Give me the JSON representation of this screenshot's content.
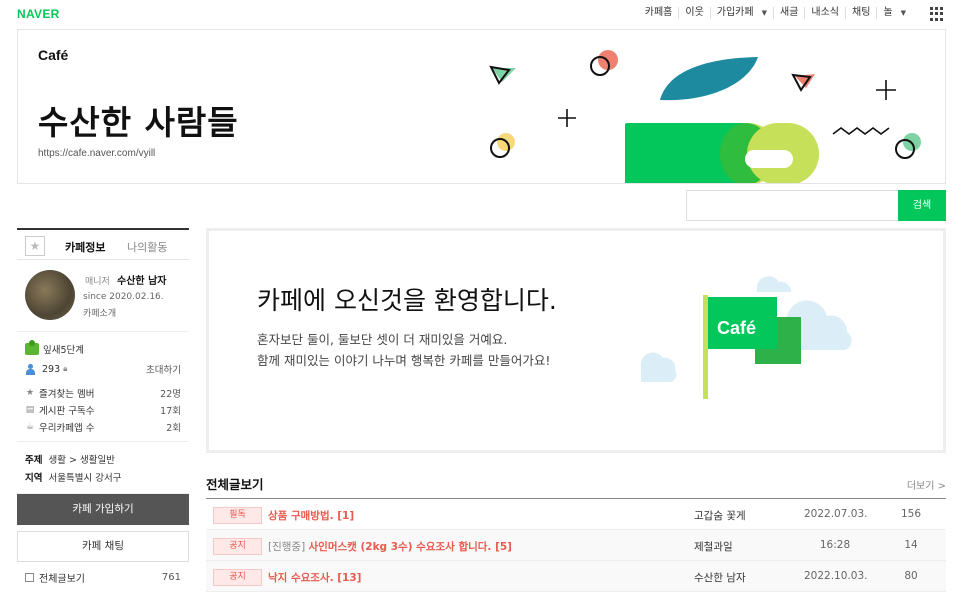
{
  "topbar": {
    "brand": "NAVER",
    "nav": [
      "카페홈",
      "이웃",
      "가입카페",
      "새글",
      "내소식",
      "채팅",
      "놀"
    ]
  },
  "header": {
    "logo": "Café",
    "title": "수산한 사람들",
    "url": "https://cafe.naver.com/vyill"
  },
  "search": {
    "button": "검색",
    "placeholder": ""
  },
  "sidebar": {
    "tabs": [
      "카페정보",
      "나의활동"
    ],
    "manager_label": "매니저",
    "manager_name": "수산한 남자",
    "since": "since 2020.02.16.",
    "intro": "카페소개",
    "level": "잎새5단계",
    "members": "293",
    "invite": "초대하기",
    "stats": [
      {
        "label": "즐겨찾는 멤버",
        "value": "22명"
      },
      {
        "label": "게시판 구독수",
        "value": "17회"
      },
      {
        "label": "우리카페앱 수",
        "value": "2회"
      }
    ],
    "topic_label": "주제",
    "topic_value": "생활 > 생활일반",
    "region_label": "지역",
    "region_value": "서울특별시 강서구",
    "join": "카페 가입하기",
    "chat": "카페 채팅",
    "all_posts": "전체글보기",
    "all_posts_count": "761"
  },
  "welcome": {
    "title": "카페에 오신것을 환영합니다.",
    "line1": "혼자보단 둘이, 둘보단 셋이 더 재미있을 거예요.",
    "line2": "함께 재미있는 이야기 나누며 행복한 카페를 만들어가요!",
    "flag_text": "Café"
  },
  "board": {
    "title": "전체글보기",
    "more": "더보기 >",
    "rows": [
      {
        "badge": "필독",
        "prefix": "",
        "subject": "상품 구매방법. [1]",
        "author": "고갑숨 꽃게",
        "date": "2022.07.03.",
        "views": "156"
      },
      {
        "badge": "공지",
        "prefix": "[진행중] ",
        "subject": "사인머스캣 (2kg 3수) 수요조사 합니다. [5]",
        "author": "제철과일",
        "date": "16:28",
        "views": "14"
      },
      {
        "badge": "공지",
        "prefix": "",
        "subject": "낙지 수요조사. [13]",
        "author": "수산한 남자",
        "date": "2022.10.03.",
        "views": "80"
      }
    ]
  }
}
